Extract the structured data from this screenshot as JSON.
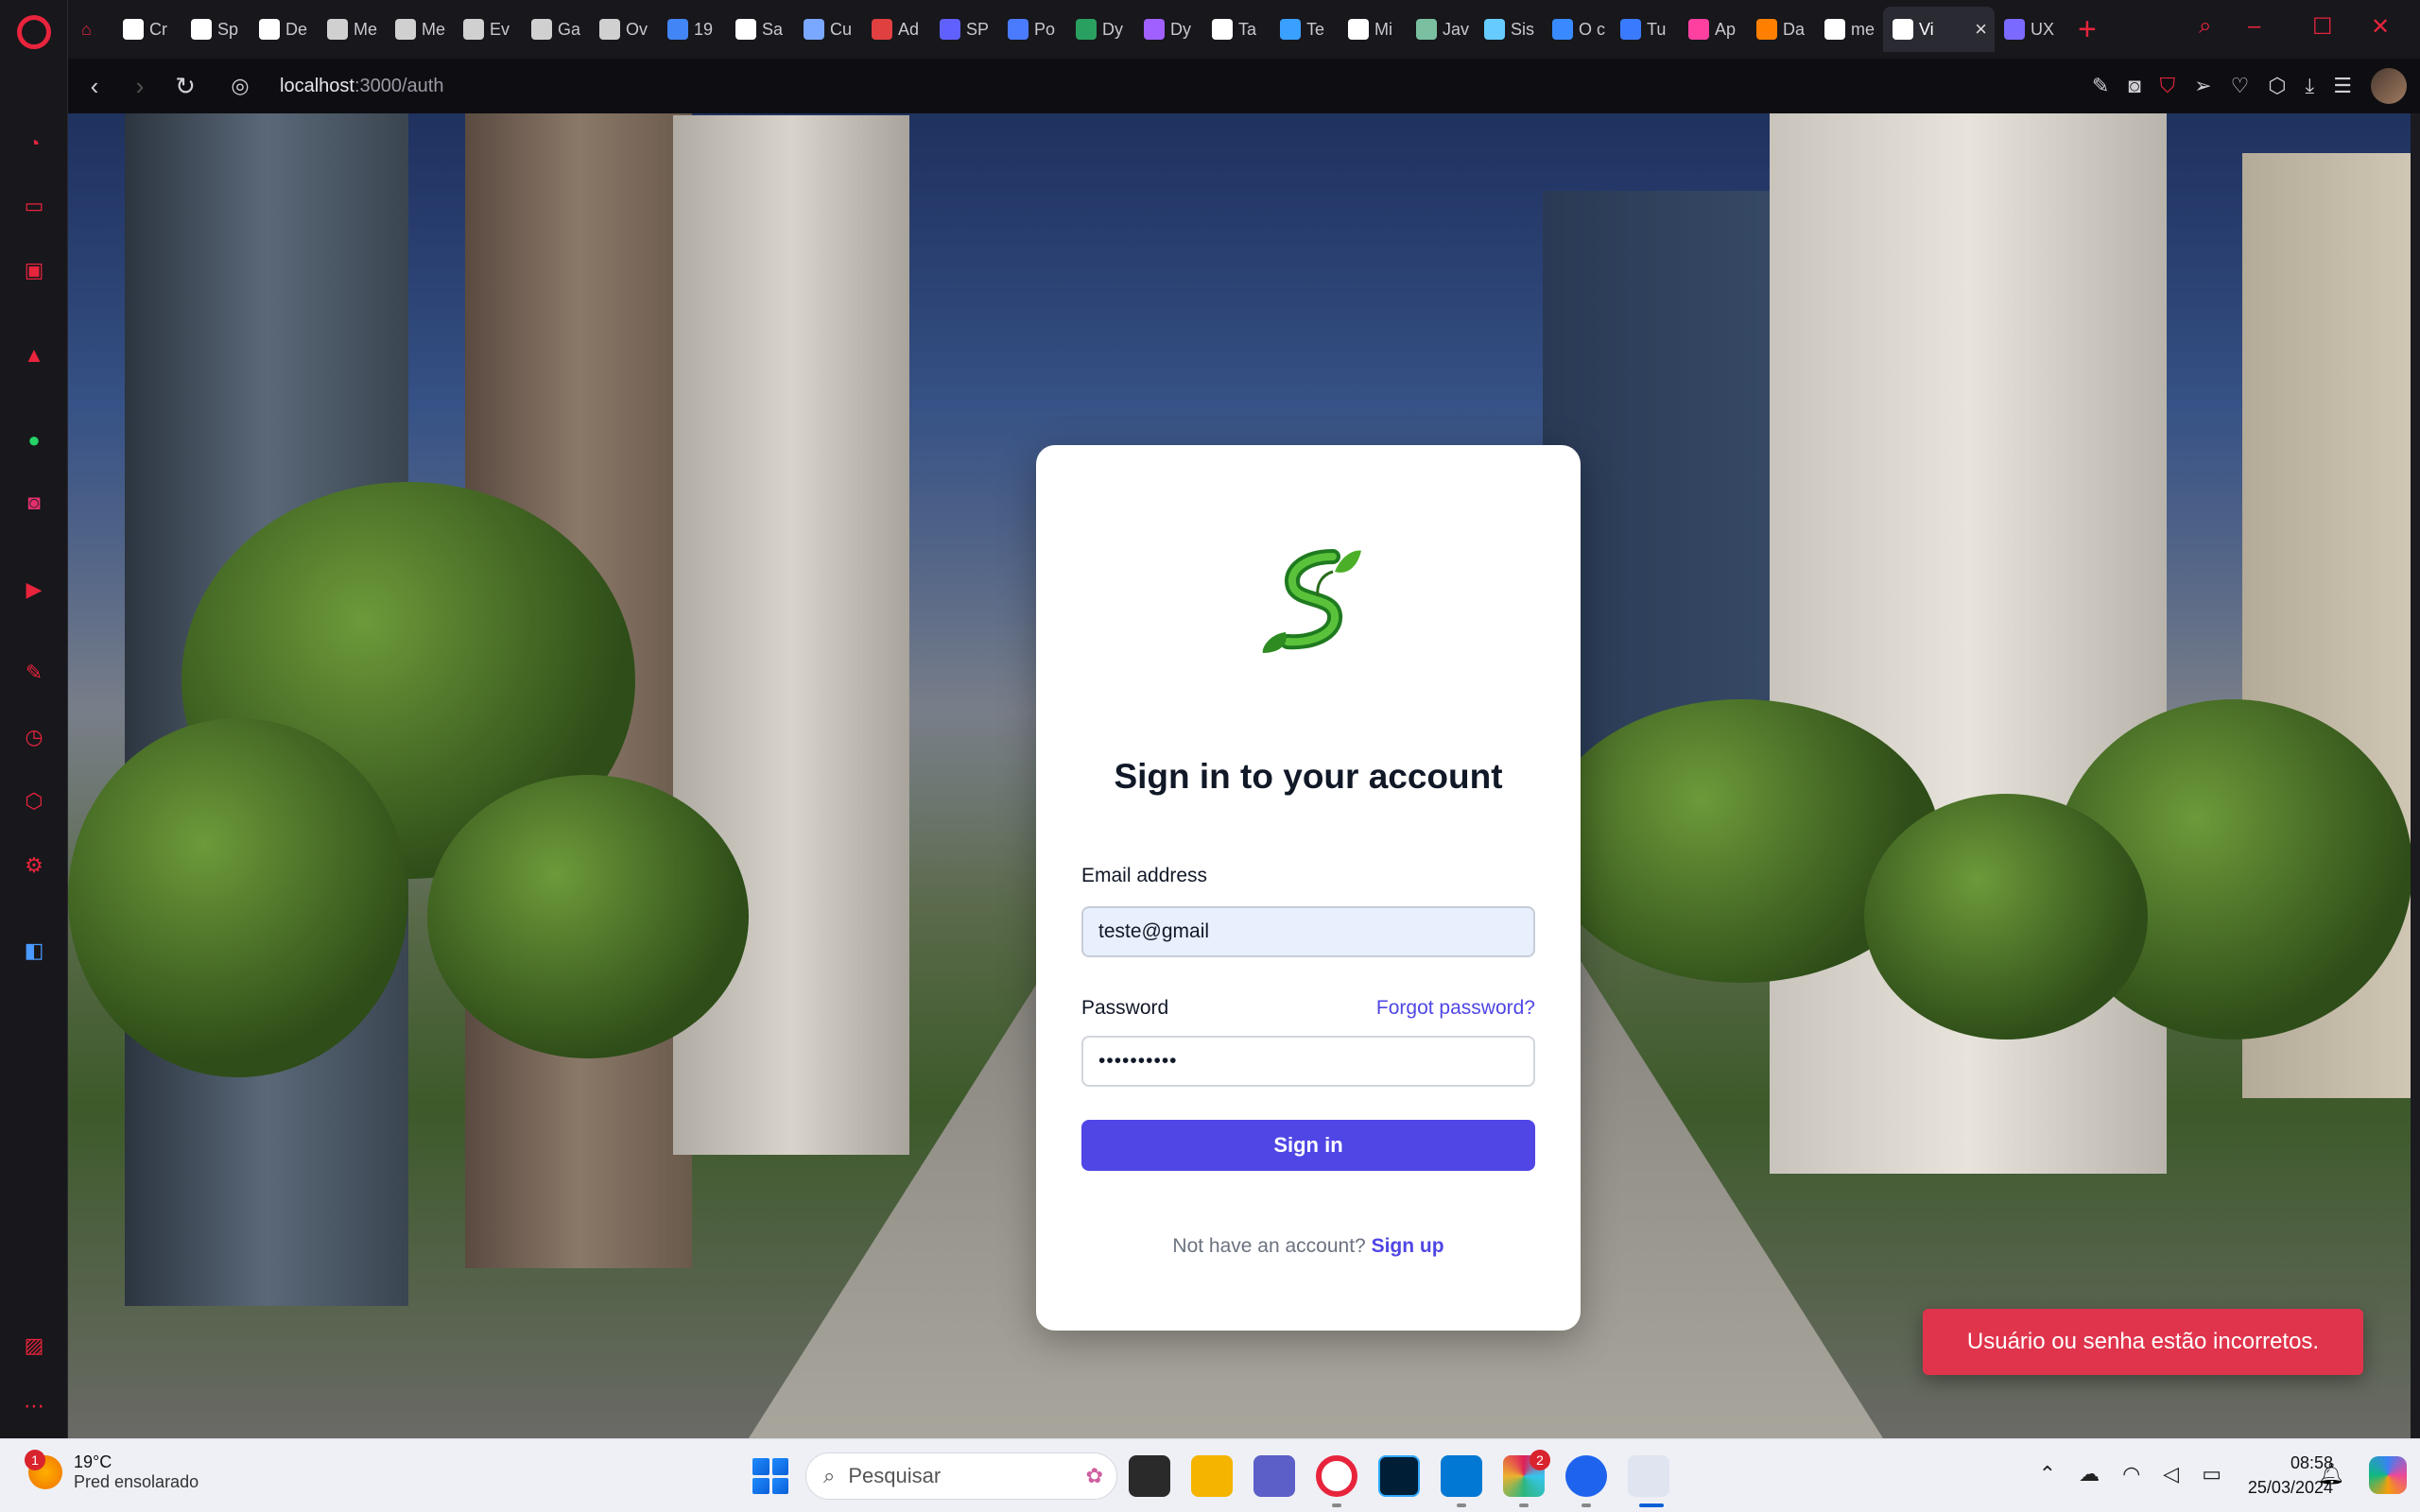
{
  "browser": {
    "tabs": [
      {
        "label": "Cr",
        "color": "#ffffff"
      },
      {
        "label": "Sp",
        "color": "#ffffff"
      },
      {
        "label": "De",
        "color": "#ffffff"
      },
      {
        "label": "Me",
        "color": "#d0d0d0"
      },
      {
        "label": "Me",
        "color": "#d0d0d0"
      },
      {
        "label": "Ev",
        "color": "#d0d0d0"
      },
      {
        "label": "Ga",
        "color": "#d0d0d0"
      },
      {
        "label": "Ov",
        "color": "#d0d0d0"
      },
      {
        "label": "19",
        "color": "#4285f4"
      },
      {
        "label": "Sa",
        "color": "#ffffff"
      },
      {
        "label": "Cu",
        "color": "#7aa7ff"
      },
      {
        "label": "Ad",
        "color": "#e04040"
      },
      {
        "label": "SP",
        "color": "#6060ff"
      },
      {
        "label": "Po",
        "color": "#4a7bff"
      },
      {
        "label": "Dy",
        "color": "#2aa060"
      },
      {
        "label": "Dy",
        "color": "#a060ff"
      },
      {
        "label": "Ta",
        "color": "#ffffff"
      },
      {
        "label": "Te",
        "color": "#3aa0ff"
      },
      {
        "label": "Mi",
        "color": "#ffffff"
      },
      {
        "label": "Jav",
        "color": "#7ac0a0"
      },
      {
        "label": "Sis",
        "color": "#66ccff"
      },
      {
        "label": "O c",
        "color": "#3a8aff"
      },
      {
        "label": "Tu",
        "color": "#3a7aff"
      },
      {
        "label": "Ap",
        "color": "#ff40a0"
      },
      {
        "label": "Da",
        "color": "#ff8000"
      },
      {
        "label": "me",
        "color": "#ffffff"
      }
    ],
    "active_tab": {
      "label": "Vi"
    },
    "last_tab": {
      "label": "UX"
    },
    "url_host": "localhost",
    "url_path": ":3000/auth"
  },
  "auth": {
    "title": "Sign in to your account",
    "email_label": "Email address",
    "email_value": "teste@gmail",
    "password_label": "Password",
    "forgot_link": "Forgot password?",
    "password_value": "••••••••••",
    "submit_label": "Sign in",
    "no_account_text": "Not have an account?",
    "signup_link": "Sign up",
    "accent_color": "#4f46e5"
  },
  "toast": {
    "message": "Usuário ou senha estão incorretos.",
    "color": "#e0344c"
  },
  "taskbar": {
    "weather_badge": "1",
    "temperature": "19°C",
    "weather_desc": "Pred ensolarado",
    "search_placeholder": "Pesquisar",
    "slack_badge": "2",
    "time": "08:58",
    "date": "25/03/2024"
  }
}
